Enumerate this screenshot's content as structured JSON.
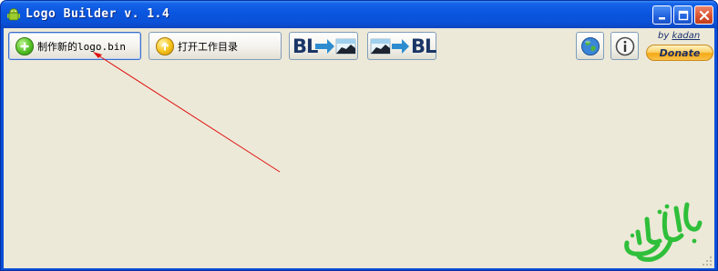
{
  "window": {
    "title": "Logo Builder v. 1.4",
    "icon": "android-icon"
  },
  "title_controls": {
    "minimize_icon": "minimize-icon",
    "maximize_icon": "maximize-icon",
    "close_icon": "close-icon"
  },
  "toolbar": {
    "new_logo_label": "制作新的logo.bin",
    "new_logo_icon": "plus-icon",
    "open_dir_label": "打开工作目录",
    "open_dir_icon": "up-arrow-icon",
    "bl_to_image": {
      "text": "BL",
      "icon": "arrow-right-icon"
    },
    "image_to_bl": {
      "text": "BL",
      "icon": "arrow-right-icon"
    },
    "globe_icon": "globe-icon",
    "info_icon": "info-icon"
  },
  "credits": {
    "by_prefix": "by",
    "author": "kadan",
    "donate_label": "Donate"
  },
  "colors": {
    "titlebar": "#0a55df",
    "client_bg": "#ece9d8",
    "annotation_arrow": "#e01010",
    "watermark": "#2fbf3a"
  }
}
